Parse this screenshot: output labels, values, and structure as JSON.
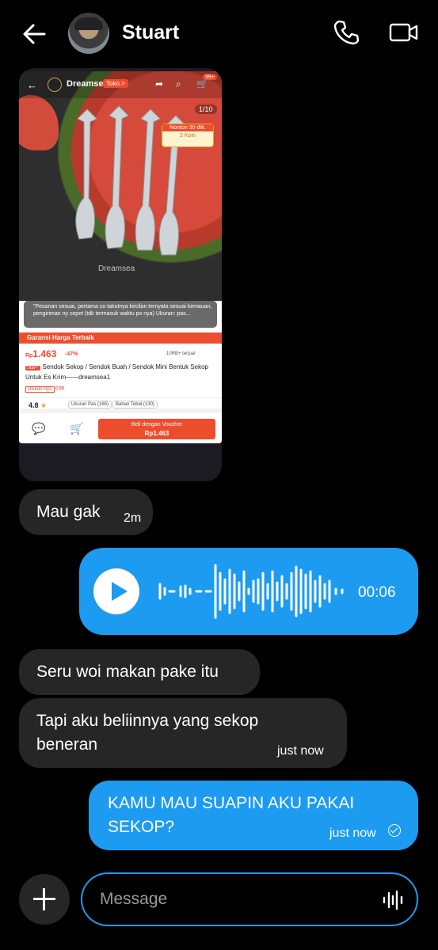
{
  "header": {
    "contact_name": "Stuart",
    "back_icon": "arrow-left-icon",
    "call_icon": "phone-icon",
    "video_icon": "video-camera-icon"
  },
  "shared_product": {
    "store_name": "Dreamsea",
    "store_tag": "Toko >",
    "cart_badge": "99+",
    "image_counter": "1/10",
    "nonton_label": "Nonton 30 dtk.",
    "coin_label": "2 Koin",
    "watermark": "Dreamsea",
    "review_text": "\"Pesanan sesuai, pertama co takutnya kecilan ternyata sesuai kemauan, pengiriman ny cepet (tdk termasuk waktu po nya)  Ukuran: pas...",
    "garansi_label": "Garansi Harga Terbaik",
    "price_currency": "Rp",
    "price": "1.463",
    "discount": "-47%",
    "sold": "10RB+ terjual",
    "star_tag": "Star+",
    "title": "Sendok Sekop / Sendok Buah / Sendok Mini Bentuk Sekop Untuk Es Krim——dreamsea1",
    "diskon_tag": "Diskon Rp1",
    "cod_tag": "COD",
    "rating": "4.8",
    "chip1": "Ukuran Pas (165)",
    "chip2": "Bahan Tebal (130)",
    "buy_label": "Beli dengan Voucher",
    "buy_price": "Rp1.463"
  },
  "messages": [
    {
      "text": "Mau gak",
      "time": "2m",
      "direction": "received"
    },
    {
      "type": "voice",
      "duration": "00:06",
      "direction": "sent"
    },
    {
      "text": "Seru woi makan pake itu",
      "direction": "received"
    },
    {
      "text_line1": "Tapi aku beliinnya yang sekop",
      "text_line2": "beneran",
      "time": "just now",
      "direction": "received"
    },
    {
      "text_line1": "KAMU MAU SUAPIN AKU PAKAI",
      "text_line2": "SEKOP?",
      "time": "just now",
      "status_icon": "check-circle-icon",
      "direction": "sent"
    }
  ],
  "composer": {
    "placeholder": "Message",
    "add_icon": "plus-icon",
    "voice_icon": "waveform-icon"
  },
  "colors": {
    "background": "#000000",
    "sent_bubble": "#1d9bf0",
    "received_bubble": "#262626",
    "shopee_orange": "#ee4d2d"
  }
}
